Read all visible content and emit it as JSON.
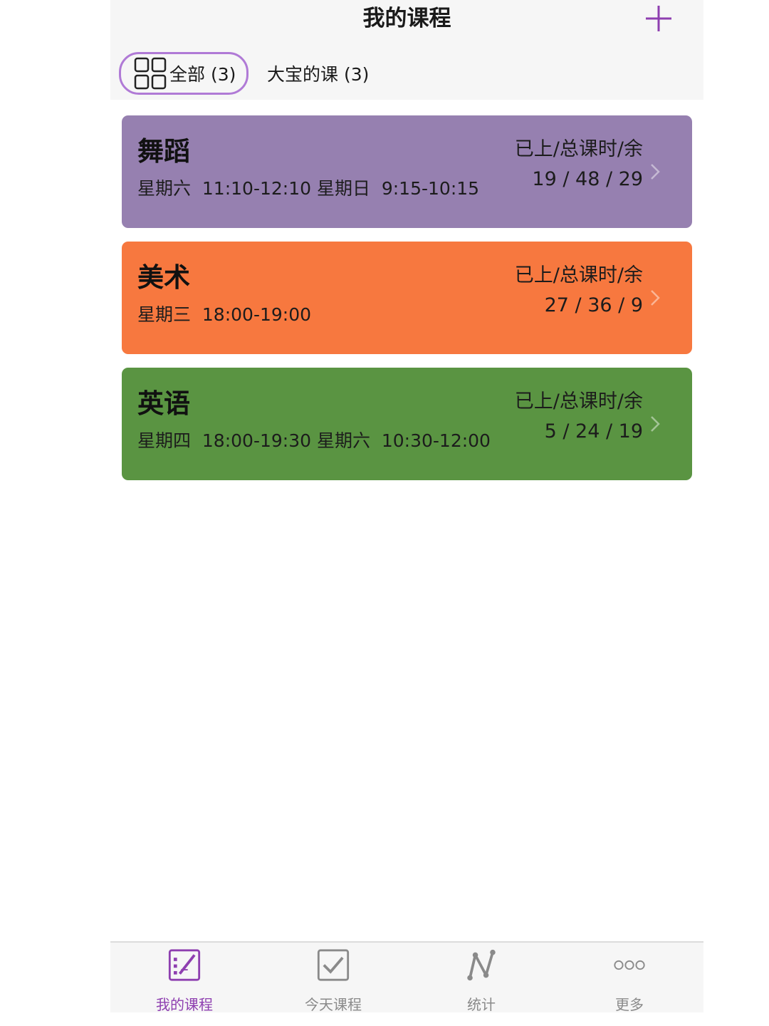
{
  "header": {
    "title": "我的课程",
    "add_icon": "plus-icon"
  },
  "filters": [
    {
      "label": "全部 (3)",
      "icon": "grid-icon",
      "selected": true
    },
    {
      "label": "大宝的课 (3)",
      "selected": false
    }
  ],
  "courses": [
    {
      "name": "舞蹈",
      "schedule": "星期六  11:10-12:10 星期日  9:15-10:15",
      "stats_label": "已上/总课时/余",
      "stats": "19 / 48 / 29",
      "color": "#9680b0"
    },
    {
      "name": "美术",
      "schedule": "星期三  18:00-19:00",
      "stats_label": "已上/总课时/余",
      "stats": "27 / 36 / 9",
      "color": "#f7783f"
    },
    {
      "name": "英语",
      "schedule": "星期四  18:00-19:30 星期六  10:30-12:00",
      "stats_label": "已上/总课时/余",
      "stats": "5 / 24 / 19",
      "color": "#5a9442"
    }
  ],
  "tabbar": [
    {
      "label": "我的课程",
      "icon": "edit-list-icon",
      "active": true
    },
    {
      "label": "今天课程",
      "icon": "checkbox-icon",
      "active": false
    },
    {
      "label": "统计",
      "icon": "stats-n-icon",
      "active": false
    },
    {
      "label": "更多",
      "icon": "more-dots-icon",
      "active": false
    }
  ],
  "colors": {
    "accent": "#8e3fb0",
    "chip_border": "#b07ad6",
    "inactive": "#8a8a8a"
  }
}
